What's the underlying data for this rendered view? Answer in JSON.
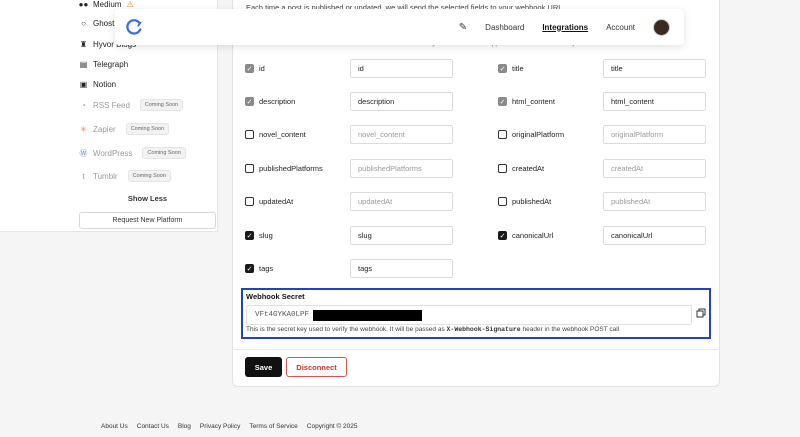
{
  "sidebar": {
    "items": [
      {
        "label": "Medium",
        "icon": "medium-icon",
        "warning": "⚠",
        "soon": ""
      },
      {
        "label": "Ghost",
        "icon": "ghost-icon",
        "soon": ""
      },
      {
        "label": "Hyvor Blogs",
        "icon": "hyvor-icon",
        "soon": ""
      },
      {
        "label": "Telegraph",
        "icon": "telegraph-icon",
        "soon": ""
      },
      {
        "label": "Notion",
        "icon": "notion-icon",
        "soon": ""
      },
      {
        "label": "RSS Feed",
        "icon": "rss-icon",
        "soon": "Coming Soon"
      },
      {
        "label": "Zapier",
        "icon": "zapier-icon",
        "soon": "Coming Soon"
      },
      {
        "label": "WordPress",
        "icon": "wordpress-icon",
        "soon": "Coming Soon"
      },
      {
        "label": "Tumblr",
        "icon": "tumblr-icon",
        "soon": "Coming Soon"
      }
    ],
    "show_less": "Show Less",
    "request_button": "Request New Platform"
  },
  "nav": {
    "dashboard": "Dashboard",
    "integrations": "Integrations",
    "account": "Account"
  },
  "main": {
    "intro": "Each time a post is published or updated, we will send the selected fields to your webhook URL.",
    "intro2": "Select which fields to include and customize their names as you want them to appear in the webhook body",
    "fields": [
      {
        "name": "id",
        "value": "id",
        "state": "grey",
        "filled": true
      },
      {
        "name": "title",
        "value": "title",
        "state": "grey",
        "filled": true
      },
      {
        "name": "description",
        "value": "description",
        "state": "grey",
        "filled": true
      },
      {
        "name": "html_content",
        "value": "html_content",
        "state": "grey",
        "filled": true
      },
      {
        "name": "novel_content",
        "value": "novel_content",
        "state": "off",
        "filled": false
      },
      {
        "name": "originalPlatform",
        "value": "originalPlatform",
        "state": "off",
        "filled": false
      },
      {
        "name": "publishedPlatforms",
        "value": "publishedPlatforms",
        "state": "off",
        "filled": false
      },
      {
        "name": "createdAt",
        "value": "createdAt",
        "state": "off",
        "filled": false
      },
      {
        "name": "updatedAt",
        "value": "updatedAt",
        "state": "off",
        "filled": false
      },
      {
        "name": "publishedAt",
        "value": "publishedAt",
        "state": "off",
        "filled": false
      },
      {
        "name": "slug",
        "value": "slug",
        "state": "on",
        "filled": true
      },
      {
        "name": "canonicalUrl",
        "value": "canonicalUrl",
        "state": "on",
        "filled": true
      },
      {
        "name": "tags",
        "value": "tags",
        "state": "on",
        "filled": true
      }
    ],
    "secret": {
      "title": "Webhook Secret",
      "value": "VFt4GYKA0LPF",
      "help_prefix": "This is the secret key used to verify the webhook. It will be passed as",
      "header_name": "X-Webhook-Signature",
      "help_suffix": "header in the webhook POST call"
    },
    "save_label": "Save",
    "disconnect_label": "Disconnect"
  },
  "footer": [
    "About Us",
    "Contact Us",
    "Blog",
    "Privacy Policy",
    "Terms of Service",
    "Copyright © 2025"
  ],
  "colors": {
    "accent": "#2741b8",
    "danger": "#d9534f",
    "primary": "#111111"
  }
}
